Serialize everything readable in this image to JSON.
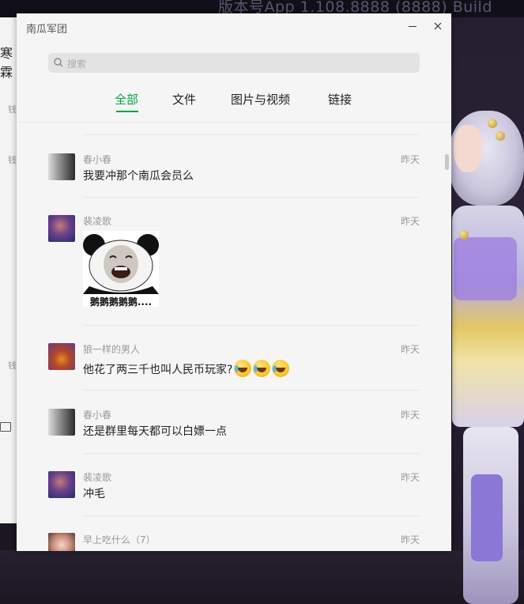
{
  "background": {
    "watermark": "版本号App 1.108.8888 (8888)  Build",
    "left_window_fragment": "寒霖"
  },
  "window": {
    "title": "南瓜军团"
  },
  "search": {
    "placeholder": "搜索"
  },
  "tabs": [
    {
      "label": "全部",
      "active": true
    },
    {
      "label": "文件",
      "active": false
    },
    {
      "label": "图片与视频",
      "active": false
    },
    {
      "label": "链接",
      "active": false
    }
  ],
  "messages": [
    {
      "sender": "春小春",
      "time": "昨天",
      "text": "我要冲那个南瓜会员么"
    },
    {
      "sender": "裴凌歌",
      "time": "昨天",
      "sticker_caption": "鹅鹅鹅鹅鹅...."
    },
    {
      "sender": "狼一样的男人",
      "time": "昨天",
      "text": "他花了两三千也叫人民币玩家?",
      "emojis": [
        "laughing-crying-emoji",
        "laughing-crying-emoji",
        "laughing-crying-emoji"
      ]
    },
    {
      "sender": "春小春",
      "time": "昨天",
      "text": "还是群里每天都可以白嫖一点"
    },
    {
      "sender": "裴凌歌",
      "time": "昨天",
      "text": "冲毛"
    },
    {
      "sender": "早上吃什么（7）",
      "time": "昨天",
      "text": ""
    }
  ],
  "colors": {
    "accent": "#07a144",
    "window_bg": "#f5f5f5"
  }
}
